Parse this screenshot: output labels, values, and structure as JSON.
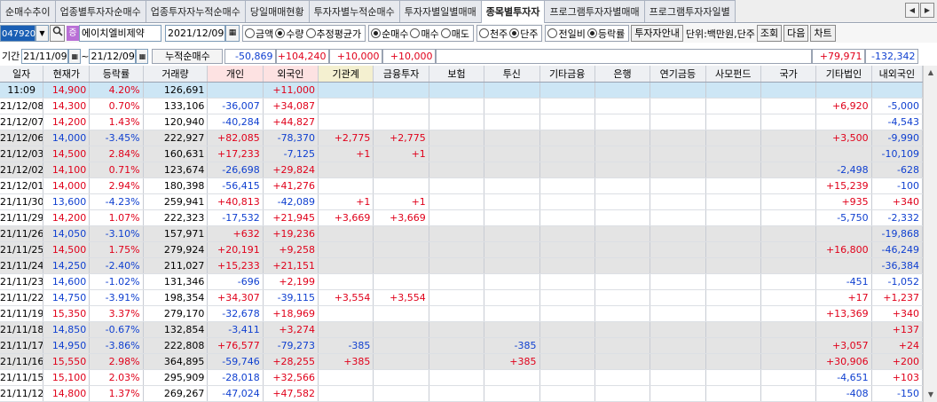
{
  "tabs": [
    "순매수추이",
    "업종별투자자순매수",
    "업종투자자누적순매수",
    "당일매매현황",
    "투자자별누적순매수",
    "투자자별일별매매",
    "종목별투자자",
    "프로그램투자자별매매",
    "프로그램투자자일별"
  ],
  "active_tab": "종목별투자자",
  "toolbar": {
    "code": "047920",
    "stock_badge": "증",
    "stock_name": "에이치엘비제약",
    "date": "2021/12/09",
    "opt1": [
      "금액",
      "수량",
      "추정평균가"
    ],
    "opt1_selected": "수량",
    "opt2": [
      "순매수",
      "매수",
      "매도"
    ],
    "opt2_selected": "순매수",
    "opt3": [
      "천주",
      "단주"
    ],
    "opt3_selected": "단주",
    "opt4": [
      "전일비",
      "등락률"
    ],
    "opt4_selected": "등락률",
    "investor_info": "투자자안내",
    "unit": "단위:백만원,단주",
    "search": "조회",
    "next": "다음",
    "chart": "차트"
  },
  "period": {
    "label": "기간",
    "from": "21/11/09",
    "tilde": "~",
    "to": "21/12/09",
    "cum_label": "누적순매수",
    "sums": {
      "individual": "-50,869",
      "foreign": "+104,240",
      "inst": "+10,000",
      "fin_invest": "+10,000",
      "other_corp": "+79,971",
      "domestic_foreign": "-132,342"
    }
  },
  "columns": [
    "일자",
    "현재가",
    "등락률",
    "거래량",
    "개인",
    "외국인",
    "기관계",
    "금융투자",
    "보험",
    "투신",
    "기타금융",
    "은행",
    "연기금등",
    "사모펀드",
    "국가",
    "기타법인",
    "내외국인"
  ],
  "rows": [
    {
      "date": "11:09",
      "price": "14,900",
      "rate": "4.20%",
      "vol": "126,691",
      "ind": "",
      "for": "+11,000",
      "inst": "",
      "fin": "",
      "ins": "",
      "trust": "",
      "etcfin": "",
      "bank": "",
      "pension": "",
      "pe": "",
      "gov": "",
      "etc": "",
      "dom": ""
    },
    {
      "date": "21/12/08",
      "price": "14,300",
      "rate": "0.70%",
      "vol": "133,106",
      "ind": "-36,007",
      "for": "+34,087",
      "inst": "",
      "fin": "",
      "ins": "",
      "trust": "",
      "etcfin": "",
      "bank": "",
      "pension": "",
      "pe": "",
      "gov": "",
      "etc": "+6,920",
      "dom": "-5,000"
    },
    {
      "date": "21/12/07",
      "price": "14,200",
      "rate": "1.43%",
      "vol": "120,940",
      "ind": "-40,284",
      "for": "+44,827",
      "inst": "",
      "fin": "",
      "ins": "",
      "trust": "",
      "etcfin": "",
      "bank": "",
      "pension": "",
      "pe": "",
      "gov": "",
      "etc": "",
      "dom": "-4,543"
    },
    {
      "date": "21/12/06",
      "price": "14,000",
      "rate": "-3.45%",
      "vol": "222,927",
      "ind": "+82,085",
      "for": "-78,370",
      "inst": "+2,775",
      "fin": "+2,775",
      "ins": "",
      "trust": "",
      "etcfin": "",
      "bank": "",
      "pension": "",
      "pe": "",
      "gov": "",
      "etc": "+3,500",
      "dom": "-9,990"
    },
    {
      "date": "21/12/03",
      "price": "14,500",
      "rate": "2.84%",
      "vol": "160,631",
      "ind": "+17,233",
      "for": "-7,125",
      "inst": "+1",
      "fin": "+1",
      "ins": "",
      "trust": "",
      "etcfin": "",
      "bank": "",
      "pension": "",
      "pe": "",
      "gov": "",
      "etc": "",
      "dom": "-10,109"
    },
    {
      "date": "21/12/02",
      "price": "14,100",
      "rate": "0.71%",
      "vol": "123,674",
      "ind": "-26,698",
      "for": "+29,824",
      "inst": "",
      "fin": "",
      "ins": "",
      "trust": "",
      "etcfin": "",
      "bank": "",
      "pension": "",
      "pe": "",
      "gov": "",
      "etc": "-2,498",
      "dom": "-628"
    },
    {
      "date": "21/12/01",
      "price": "14,000",
      "rate": "2.94%",
      "vol": "180,398",
      "ind": "-56,415",
      "for": "+41,276",
      "inst": "",
      "fin": "",
      "ins": "",
      "trust": "",
      "etcfin": "",
      "bank": "",
      "pension": "",
      "pe": "",
      "gov": "",
      "etc": "+15,239",
      "dom": "-100"
    },
    {
      "date": "21/11/30",
      "price": "13,600",
      "rate": "-4.23%",
      "vol": "259,941",
      "ind": "+40,813",
      "for": "-42,089",
      "inst": "+1",
      "fin": "+1",
      "ins": "",
      "trust": "",
      "etcfin": "",
      "bank": "",
      "pension": "",
      "pe": "",
      "gov": "",
      "etc": "+935",
      "dom": "+340"
    },
    {
      "date": "21/11/29",
      "price": "14,200",
      "rate": "1.07%",
      "vol": "222,323",
      "ind": "-17,532",
      "for": "+21,945",
      "inst": "+3,669",
      "fin": "+3,669",
      "ins": "",
      "trust": "",
      "etcfin": "",
      "bank": "",
      "pension": "",
      "pe": "",
      "gov": "",
      "etc": "-5,750",
      "dom": "-2,332"
    },
    {
      "date": "21/11/26",
      "price": "14,050",
      "rate": "-3.10%",
      "vol": "157,971",
      "ind": "+632",
      "for": "+19,236",
      "inst": "",
      "fin": "",
      "ins": "",
      "trust": "",
      "etcfin": "",
      "bank": "",
      "pension": "",
      "pe": "",
      "gov": "",
      "etc": "",
      "dom": "-19,868"
    },
    {
      "date": "21/11/25",
      "price": "14,500",
      "rate": "1.75%",
      "vol": "279,924",
      "ind": "+20,191",
      "for": "+9,258",
      "inst": "",
      "fin": "",
      "ins": "",
      "trust": "",
      "etcfin": "",
      "bank": "",
      "pension": "",
      "pe": "",
      "gov": "",
      "etc": "+16,800",
      "dom": "-46,249"
    },
    {
      "date": "21/11/24",
      "price": "14,250",
      "rate": "-2.40%",
      "vol": "211,027",
      "ind": "+15,233",
      "for": "+21,151",
      "inst": "",
      "fin": "",
      "ins": "",
      "trust": "",
      "etcfin": "",
      "bank": "",
      "pension": "",
      "pe": "",
      "gov": "",
      "etc": "",
      "dom": "-36,384"
    },
    {
      "date": "21/11/23",
      "price": "14,600",
      "rate": "-1.02%",
      "vol": "131,346",
      "ind": "-696",
      "for": "+2,199",
      "inst": "",
      "fin": "",
      "ins": "",
      "trust": "",
      "etcfin": "",
      "bank": "",
      "pension": "",
      "pe": "",
      "gov": "",
      "etc": "-451",
      "dom": "-1,052"
    },
    {
      "date": "21/11/22",
      "price": "14,750",
      "rate": "-3.91%",
      "vol": "198,354",
      "ind": "+34,307",
      "for": "-39,115",
      "inst": "+3,554",
      "fin": "+3,554",
      "ins": "",
      "trust": "",
      "etcfin": "",
      "bank": "",
      "pension": "",
      "pe": "",
      "gov": "",
      "etc": "+17",
      "dom": "+1,237"
    },
    {
      "date": "21/11/19",
      "price": "15,350",
      "rate": "3.37%",
      "vol": "279,170",
      "ind": "-32,678",
      "for": "+18,969",
      "inst": "",
      "fin": "",
      "ins": "",
      "trust": "",
      "etcfin": "",
      "bank": "",
      "pension": "",
      "pe": "",
      "gov": "",
      "etc": "+13,369",
      "dom": "+340"
    },
    {
      "date": "21/11/18",
      "price": "14,850",
      "rate": "-0.67%",
      "vol": "132,854",
      "ind": "-3,411",
      "for": "+3,274",
      "inst": "",
      "fin": "",
      "ins": "",
      "trust": "",
      "etcfin": "",
      "bank": "",
      "pension": "",
      "pe": "",
      "gov": "",
      "etc": "",
      "dom": "+137"
    },
    {
      "date": "21/11/17",
      "price": "14,950",
      "rate": "-3.86%",
      "vol": "222,808",
      "ind": "+76,577",
      "for": "-79,273",
      "inst": "-385",
      "fin": "",
      "ins": "",
      "trust": "-385",
      "etcfin": "",
      "bank": "",
      "pension": "",
      "pe": "",
      "gov": "",
      "etc": "+3,057",
      "dom": "+24"
    },
    {
      "date": "21/11/16",
      "price": "15,550",
      "rate": "2.98%",
      "vol": "364,895",
      "ind": "-59,746",
      "for": "+28,255",
      "inst": "+385",
      "fin": "",
      "ins": "",
      "trust": "+385",
      "etcfin": "",
      "bank": "",
      "pension": "",
      "pe": "",
      "gov": "",
      "etc": "+30,906",
      "dom": "+200"
    },
    {
      "date": "21/11/15",
      "price": "15,100",
      "rate": "2.03%",
      "vol": "295,909",
      "ind": "-28,018",
      "for": "+32,566",
      "inst": "",
      "fin": "",
      "ins": "",
      "trust": "",
      "etcfin": "",
      "bank": "",
      "pension": "",
      "pe": "",
      "gov": "",
      "etc": "-4,651",
      "dom": "+103"
    },
    {
      "date": "21/11/12",
      "price": "14,800",
      "rate": "1.37%",
      "vol": "269,267",
      "ind": "-47,024",
      "for": "+47,582",
      "inst": "",
      "fin": "",
      "ins": "",
      "trust": "",
      "etcfin": "",
      "bank": "",
      "pension": "",
      "pe": "",
      "gov": "",
      "etc": "-408",
      "dom": "-150"
    }
  ],
  "colors": {
    "up": "#e0001a",
    "down": "#1040d0",
    "highlight_row": "#cde6f5",
    "band_row": "#e4e4e4"
  }
}
